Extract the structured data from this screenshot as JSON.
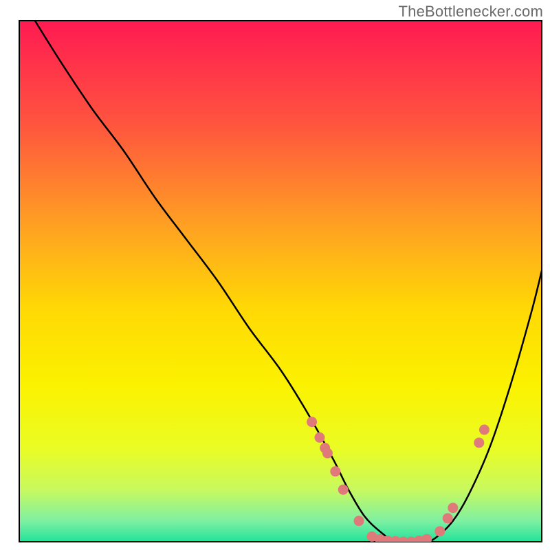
{
  "source_label": "TheBottlenecker.com",
  "chart_data": {
    "type": "line",
    "title": "",
    "xlabel": "",
    "ylabel": "",
    "xlim": [
      0,
      100
    ],
    "ylim": [
      0,
      100
    ],
    "axes_visible": false,
    "line_color": "#000000",
    "dot_color": "#e07a7a",
    "background": "rainbow_vertical_gradient",
    "gradient_stops": [
      {
        "pos": 0.0,
        "color": "#ff1a52"
      },
      {
        "pos": 0.2,
        "color": "#ff553e"
      },
      {
        "pos": 0.4,
        "color": "#ffa321"
      },
      {
        "pos": 0.55,
        "color": "#ffd805"
      },
      {
        "pos": 0.7,
        "color": "#fbf200"
      },
      {
        "pos": 0.82,
        "color": "#eafc24"
      },
      {
        "pos": 0.9,
        "color": "#c8f95e"
      },
      {
        "pos": 0.96,
        "color": "#7ef0a2"
      },
      {
        "pos": 1.0,
        "color": "#22e39a"
      }
    ],
    "series": [
      {
        "name": "bottleneck_curve",
        "x": [
          0,
          3,
          8,
          14,
          20,
          26,
          32,
          38,
          44,
          50,
          55,
          60,
          63,
          66,
          69,
          72,
          75,
          78,
          80,
          83,
          86,
          90,
          94,
          98,
          100
        ],
        "y": [
          105,
          100,
          92,
          83,
          75,
          66,
          58,
          50,
          41,
          33,
          25,
          16,
          10,
          5,
          2,
          0,
          0,
          0,
          1,
          4,
          9,
          18,
          30,
          44,
          52
        ]
      }
    ],
    "highlight_points": [
      {
        "x": 56.0,
        "y": 23.0
      },
      {
        "x": 57.5,
        "y": 20.0
      },
      {
        "x": 58.5,
        "y": 18.0
      },
      {
        "x": 59.0,
        "y": 17.0
      },
      {
        "x": 60.5,
        "y": 13.5
      },
      {
        "x": 62.0,
        "y": 10.0
      },
      {
        "x": 65.0,
        "y": 4.0
      },
      {
        "x": 67.5,
        "y": 1.0
      },
      {
        "x": 69.0,
        "y": 0.5
      },
      {
        "x": 70.5,
        "y": 0.2
      },
      {
        "x": 72.0,
        "y": 0.1
      },
      {
        "x": 73.5,
        "y": 0.0
      },
      {
        "x": 75.0,
        "y": 0.0
      },
      {
        "x": 76.5,
        "y": 0.2
      },
      {
        "x": 78.0,
        "y": 0.5
      },
      {
        "x": 80.5,
        "y": 2.0
      },
      {
        "x": 82.0,
        "y": 4.5
      },
      {
        "x": 83.0,
        "y": 6.5
      },
      {
        "x": 88.0,
        "y": 19.0
      },
      {
        "x": 89.0,
        "y": 21.5
      }
    ]
  }
}
